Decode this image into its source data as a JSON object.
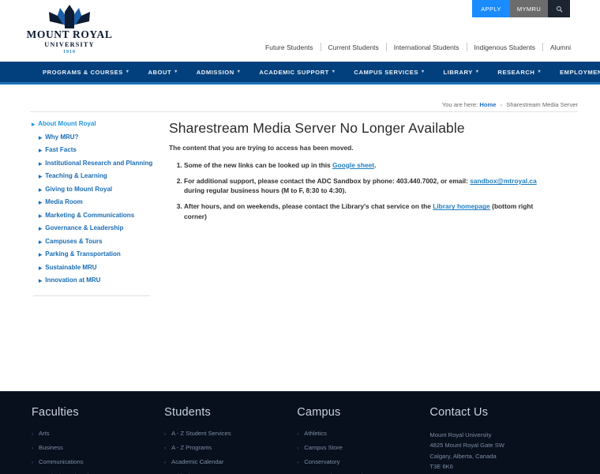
{
  "utility": {
    "apply_label": "APPLY",
    "mymru_label": "MYMRU",
    "search_icon": "search-icon"
  },
  "logo": {
    "wordmark": "MOUNT ROYAL",
    "subtitle": "UNIVERSITY",
    "year": "1910"
  },
  "audience_nav": {
    "items": [
      {
        "label": "Future Students"
      },
      {
        "label": "Current Students"
      },
      {
        "label": "International Students"
      },
      {
        "label": "Indigenous Students"
      },
      {
        "label": "Alumni"
      }
    ]
  },
  "mainnav": {
    "items": [
      {
        "label": "PROGRAMS & COURSES",
        "caret": true
      },
      {
        "label": "ABOUT",
        "caret": true
      },
      {
        "label": "ADMISSION",
        "caret": true
      },
      {
        "label": "ACADEMIC SUPPORT",
        "caret": true
      },
      {
        "label": "CAMPUS SERVICES",
        "caret": true
      },
      {
        "label": "LIBRARY",
        "caret": true
      },
      {
        "label": "RESEARCH",
        "caret": true
      },
      {
        "label": "EMPLOYMENT & CAREERS",
        "caret": true
      }
    ]
  },
  "breadcrumb": {
    "prefix": "You are here:",
    "home_label": "Home",
    "separator": "›",
    "current": "Sharestream Media Server"
  },
  "sidebar": {
    "items": [
      {
        "label": "About Mount Royal",
        "level": "top"
      },
      {
        "label": "Why MRU?",
        "level": "sub"
      },
      {
        "label": "Fast Facts",
        "level": "sub"
      },
      {
        "label": "Institutional Research and Planning",
        "level": "sub"
      },
      {
        "label": "Teaching & Learning",
        "level": "sub"
      },
      {
        "label": "Giving to Mount Royal",
        "level": "sub"
      },
      {
        "label": "Media Room",
        "level": "sub"
      },
      {
        "label": "Marketing & Communications",
        "level": "sub"
      },
      {
        "label": "Governance & Leadership",
        "level": "sub"
      },
      {
        "label": "Campuses & Tours",
        "level": "sub"
      },
      {
        "label": "Parking & Transportation",
        "level": "sub"
      },
      {
        "label": "Sustainable MRU",
        "level": "sub"
      },
      {
        "label": "Innovation at MRU",
        "level": "sub"
      }
    ]
  },
  "main": {
    "title": "Sharestream Media Server No Longer Available",
    "intro": "The content that you are trying to access has been moved.",
    "steps": [
      {
        "before": "Some of the new links can be looked up in this ",
        "link": "Google sheet",
        "after": "."
      },
      {
        "before": "For additional support, please contact the ADC Sandbox by phone: 403.440.7002, or email: ",
        "link": "sandbox@mtroyal.ca",
        "after": " during regular business hours (M to F, 8:30 to 4:30)."
      },
      {
        "before": "After hours, and on weekends, please contact the Library's chat service on the ",
        "link": "Library homepage",
        "after": " (bottom right corner)"
      }
    ]
  },
  "footer": {
    "columns": [
      {
        "heading": "Faculties",
        "links": [
          {
            "label": "Arts"
          },
          {
            "label": "Business"
          },
          {
            "label": "Communications"
          },
          {
            "label": "Continuing Education"
          }
        ]
      },
      {
        "heading": "Students",
        "links": [
          {
            "label": "A - Z Student Services"
          },
          {
            "label": "A - Z Programs"
          },
          {
            "label": "Academic Calendar"
          },
          {
            "label": "Critical Dates"
          }
        ]
      },
      {
        "heading": "Campus",
        "links": [
          {
            "label": "Athletics"
          },
          {
            "label": "Campus Store"
          },
          {
            "label": "Conservatory"
          },
          {
            "label": "Event & Theatre Services"
          }
        ]
      }
    ],
    "contact": {
      "heading": "Contact Us",
      "lines": [
        "Mount Royal University",
        "4825 Mount Royal Gate SW",
        "Calgary, Alberta, Canada",
        "T3E 6K6"
      ]
    }
  },
  "colors": {
    "nav_blue": "#02407d",
    "nav_underline": "#1d72b8",
    "apply_blue": "#1a8cff",
    "mymru_gray": "#6c6c6c",
    "search_dark": "#1b2430",
    "link_blue": "#1f7fc4",
    "sidebar_top_blue": "#2196e3",
    "footer_bg": "#080f1d",
    "footer_text": "#7c8da3"
  }
}
